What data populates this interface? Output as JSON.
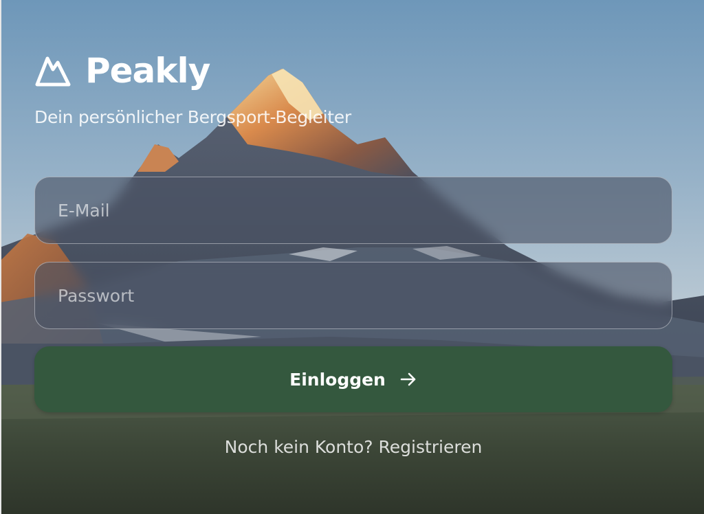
{
  "app": {
    "name": "Peakly",
    "tagline": "Dein persönlicher Bergsport-Begleiter",
    "logo_icon": "mountain-icon"
  },
  "form": {
    "email": {
      "placeholder": "E-Mail",
      "value": ""
    },
    "password": {
      "placeholder": "Passwort",
      "value": ""
    },
    "submit": {
      "label": "Einloggen",
      "icon": "arrow-right-icon"
    }
  },
  "footer": {
    "prompt": "Noch kein Konto?",
    "link": "Registrieren"
  },
  "colors": {
    "primary_button": "#34583e",
    "text": "#ffffff",
    "sky_top": "#6d96b8",
    "sky_bottom": "#b8c9d6"
  }
}
